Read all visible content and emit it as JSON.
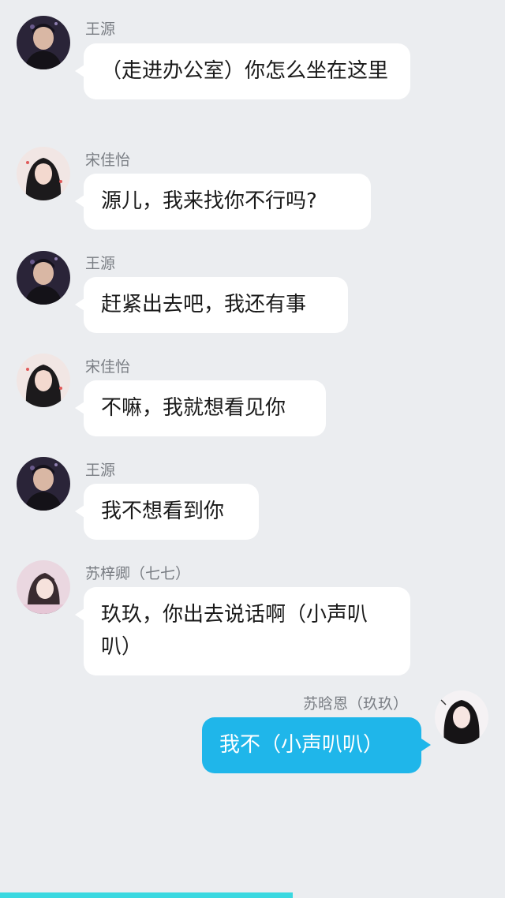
{
  "messages": [
    {
      "sender": "王源",
      "text": "（走进办公室）你怎么坐在这里",
      "side": "left",
      "avatar": "boy-avatar"
    },
    {
      "sender": "宋佳怡",
      "text": "源儿，我来找你不行吗?",
      "side": "left",
      "avatar": "girl-avatar-1"
    },
    {
      "sender": "王源",
      "text": "赶紧出去吧，我还有事",
      "side": "left",
      "avatar": "boy-avatar"
    },
    {
      "sender": "宋佳怡",
      "text": "不嘛，我就想看见你",
      "side": "left",
      "avatar": "girl-avatar-1"
    },
    {
      "sender": "王源",
      "text": "我不想看到你",
      "side": "left",
      "avatar": "boy-avatar"
    },
    {
      "sender": "苏梓卿（七七）",
      "text": "玖玖，你出去说话啊（小声叭叭）",
      "side": "left",
      "avatar": "girl-avatar-2"
    },
    {
      "sender": "苏晗恩（玖玖）",
      "text": "我不（小声叭叭）",
      "side": "right",
      "avatar": "girl-avatar-3"
    }
  ],
  "colors": {
    "background": "#ebedf0",
    "incoming_bubble": "#ffffff",
    "outgoing_bubble": "#1fb6ea",
    "sender_text": "#7a7e84",
    "progress": "#3ad8e0"
  },
  "progress": {
    "fraction": 0.58
  }
}
